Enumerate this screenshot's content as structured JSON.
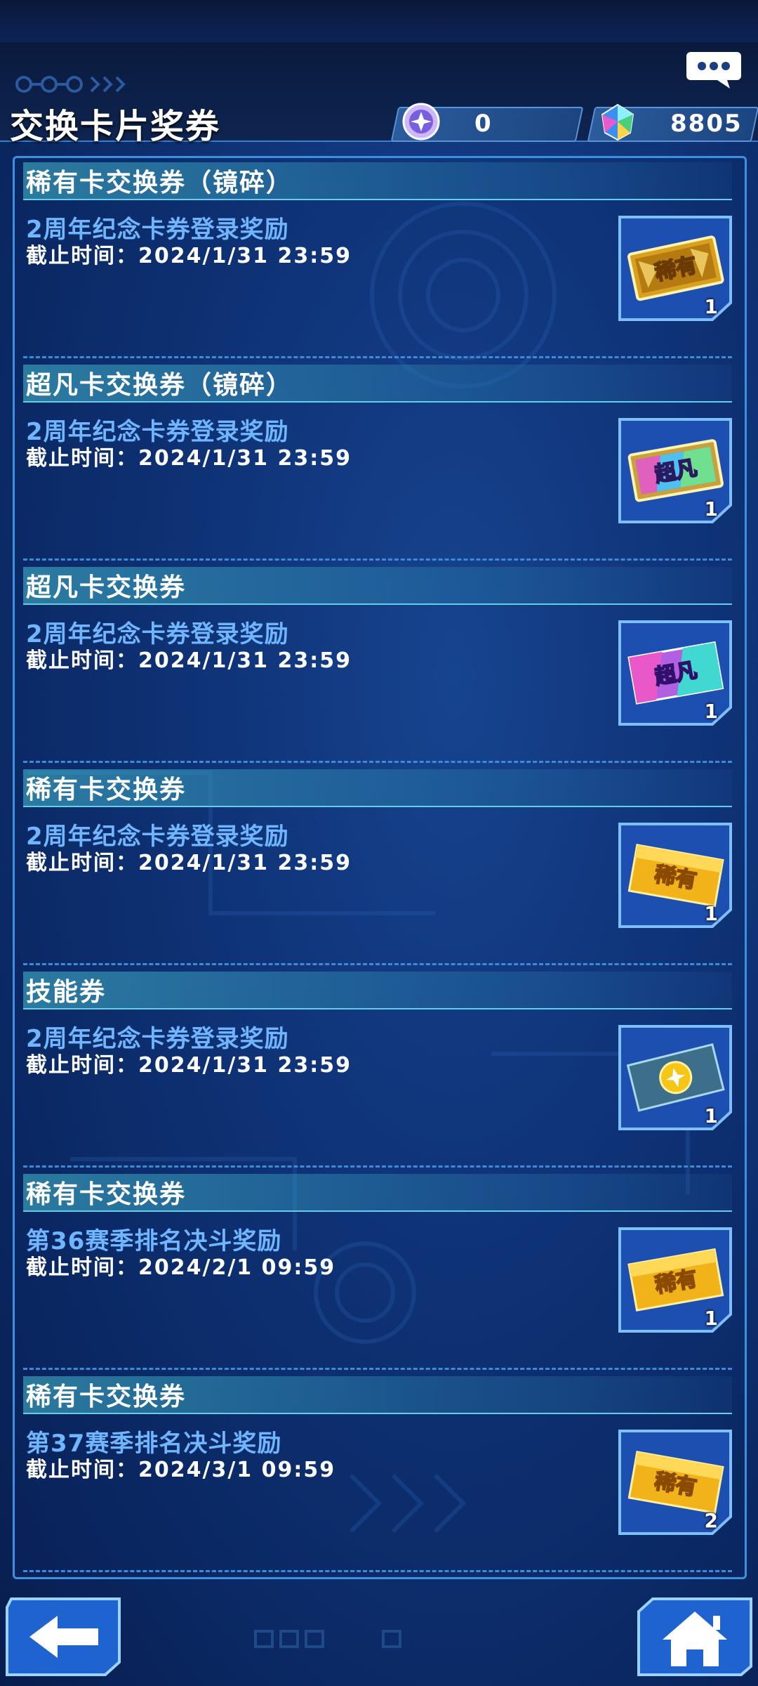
{
  "header": {
    "title": "交换卡片奖券",
    "chat_icon": "chat-bubble-icon",
    "currencies": [
      {
        "icon": "purple-orb-icon",
        "value": "0"
      },
      {
        "icon": "rainbow-gem-icon",
        "value": "8805"
      }
    ]
  },
  "rows": [
    {
      "title": "稀有卡交换券（镜碎）",
      "subtitle": "2周年纪念卡券登录奖励",
      "deadline": "截止时间：2024/1/31 23:59",
      "ticket_icon": "rare-shine-ticket-icon",
      "ticket_text": "稀有",
      "count": "1"
    },
    {
      "title": "超凡卡交换券（镜碎）",
      "subtitle": "2周年纪念卡券登录奖励",
      "deadline": "截止时间：2024/1/31 23:59",
      "ticket_icon": "super-shine-ticket-icon",
      "ticket_text": "超凡",
      "count": "1"
    },
    {
      "title": "超凡卡交换券",
      "subtitle": "2周年纪念卡券登录奖励",
      "deadline": "截止时间：2024/1/31 23:59",
      "ticket_icon": "super-ticket-icon",
      "ticket_text": "超凡",
      "count": "1"
    },
    {
      "title": "稀有卡交换券",
      "subtitle": "2周年纪念卡券登录奖励",
      "deadline": "截止时间：2024/1/31 23:59",
      "ticket_icon": "rare-ticket-icon",
      "ticket_text": "稀有",
      "count": "1"
    },
    {
      "title": "技能券",
      "subtitle": "2周年纪念卡券登录奖励",
      "deadline": "截止时间：2024/1/31 23:59",
      "ticket_icon": "skill-ticket-icon",
      "ticket_text": "",
      "count": "1"
    },
    {
      "title": "稀有卡交换券",
      "subtitle": "第36赛季排名决斗奖励",
      "deadline": "截止时间：2024/2/1 09:59",
      "ticket_icon": "rare-ticket-icon",
      "ticket_text": "稀有",
      "count": "1"
    },
    {
      "title": "稀有卡交换券",
      "subtitle": "第37赛季排名决斗奖励",
      "deadline": "截止时间：2024/3/1 09:59",
      "ticket_icon": "rare-ticket-icon",
      "ticket_text": "稀有",
      "count": "2"
    }
  ],
  "nav": {
    "back_icon": "back-arrow-icon",
    "home_icon": "home-icon"
  },
  "colors": {
    "background": "#123a82",
    "panel_border": "#3d8fe0",
    "subtitle_blue": "#6fb6ff",
    "row_header_teal": "#46bed2",
    "rare_gold": "#f2b21a"
  }
}
